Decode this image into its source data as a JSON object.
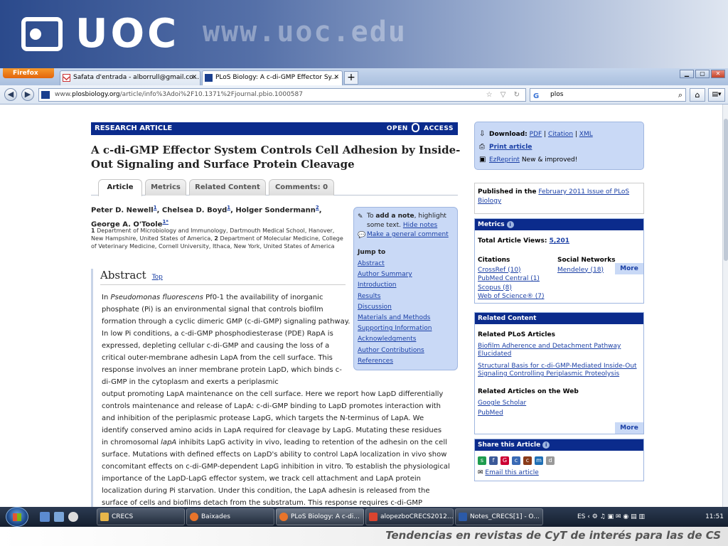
{
  "banner": {
    "logo_text": "UOC",
    "url_text": "www.uoc.edu"
  },
  "browser": {
    "app_button": "Firefox",
    "tabs": [
      {
        "label": "Safata d'entrada - alborrull@gmail.co..."
      },
      {
        "label": "PLoS Biology: A c-di-GMP Effector Sy..."
      }
    ],
    "new_tab": "+",
    "url_prefix": "www.",
    "url_domain": "plosbiology.org",
    "url_path": "/article/info%3Adoi%2F10.1371%2Fjournal.pbio.1000587",
    "search_value": "plos"
  },
  "article": {
    "type_label": "RESEARCH ARTICLE",
    "open_label": "OPEN",
    "access_label": "ACCESS",
    "title": "A c-di-GMP Effector System Controls Cell Adhesion by Inside-Out Signaling and Surface Protein Cleavage",
    "tabs": [
      "Article",
      "Metrics",
      "Related Content",
      "Comments: 0"
    ],
    "authors": [
      {
        "name": "Peter D. Newell",
        "sup": "1"
      },
      {
        "name": "Chelsea D. Boyd",
        "sup": "1"
      },
      {
        "name": "Holger Sondermann",
        "sup": "2"
      },
      {
        "name": "George A. O'Toole",
        "sup": "1*"
      }
    ],
    "affil_1_num": "1",
    "affil_1": "Department of Microbiology and Immunology, Dartmouth Medical School, Hanover, New Hampshire, United States of America,",
    "affil_2_num": "2",
    "affil_2": "Department of Molecular Medicine, College of Veterinary Medicine, Cornell University, Ithaca, New York, United States of America",
    "abstract_heading": "Abstract",
    "abstract_top": "Top",
    "abstract_p1_pre": "In ",
    "abstract_p1_species": "Pseudomonas fluorescens",
    "abstract_p1_a": " Pf0-1 the availability of inorganic phosphate (Pi) is an environmental signal that controls biofilm formation through a cyclic dimeric GMP (c-di-GMP) signaling pathway. In low Pi conditions, a c-di-GMP phosphodiesterase (PDE) RapA is expressed, depleting cellular c-di-GMP and causing the loss of a critical outer-membrane adhesin LapA from the cell surface. This response involves an inner membrane protein LapD, which binds c-di-GMP in the cytoplasm and exerts a periplasmic",
    "abstract_p1_b": "output promoting LapA maintenance on the cell surface. Here we report how LapD differentially controls maintenance and release of LapA: c-di-GMP binding to LapD promotes interaction with and inhibition of the periplasmic protease LapG, which targets the N-terminus of LapA. We identify conserved amino acids in LapA required for cleavage by LapG. Mutating these residues in chromosomal ",
    "abstract_p1_gene": "lapA",
    "abstract_p1_c": " inhibits LapG activity in vivo, leading to retention of the adhesin on the cell surface. Mutations with defined effects on LapD's ability to control LapA localization in vivo show concomitant effects on c-di-GMP-dependent LapG inhibition in vitro. To establish the physiological importance of the LapD-LapG effector system, we track cell attachment and LapA protein localization during Pi starvation. Under this condition, the LapA adhesin is released from the surface of cells and biofilms detach from the substratum. This response requires c-di-GMP"
  },
  "notes": {
    "to": "To ",
    "add_note": "add a note",
    "rest": ", highlight some text. ",
    "hide_notes": "Hide notes",
    "general_comment": "Make a general comment",
    "jump_to": "Jump to",
    "jump_links": [
      "Abstract",
      "Author Summary",
      "Introduction",
      "Results",
      "Discussion",
      "Materials and Methods",
      "Supporting Information",
      "Acknowledgments",
      "Author Contributions",
      "References"
    ]
  },
  "sidebar": {
    "download_label": "Download:",
    "download_pdf": "PDF",
    "download_citation": "Citation",
    "download_xml": "XML",
    "print_article": "Print article",
    "ezreprint": "EzReprint",
    "ezreprint_note": "New & improved!",
    "published_in": "Published in the",
    "issue_link": "February 2011 Issue of PLoS Biology",
    "metrics_title": "Metrics",
    "total_views_label": "Total Article Views:",
    "total_views": "5,201",
    "citations_title": "Citations",
    "citations": [
      "CrossRef (10)",
      "PubMed Central (1)",
      "Scopus (8)",
      "Web of Science® (7)"
    ],
    "social_title": "Social Networks",
    "social": [
      "Mendeley (18)"
    ],
    "more": "More",
    "related_title": "Related Content",
    "related_plos_title": "Related PLoS Articles",
    "related_plos": [
      "Biofilm Adherence and Detachment Pathway Elucidated",
      "Structural Basis for c-di-GMP-Mediated Inside-Out Signaling Controlling Periplasmic Proteolysis"
    ],
    "related_web_title": "Related Articles on the Web",
    "related_web": [
      "Google Scholar",
      "PubMed"
    ],
    "share_title": "Share this Article",
    "email_article": "Email this article"
  },
  "taskbar": {
    "items": [
      "CRECS",
      "Baixades",
      "PLoS Biology: A c-di...",
      "alopezboCRECS2012...",
      "Notes_CRECS[1] - O..."
    ],
    "lang": "ES",
    "clock": "11:51"
  },
  "footer": {
    "caption": "Tendencias en revistas de CyT de interés para las de CS"
  }
}
